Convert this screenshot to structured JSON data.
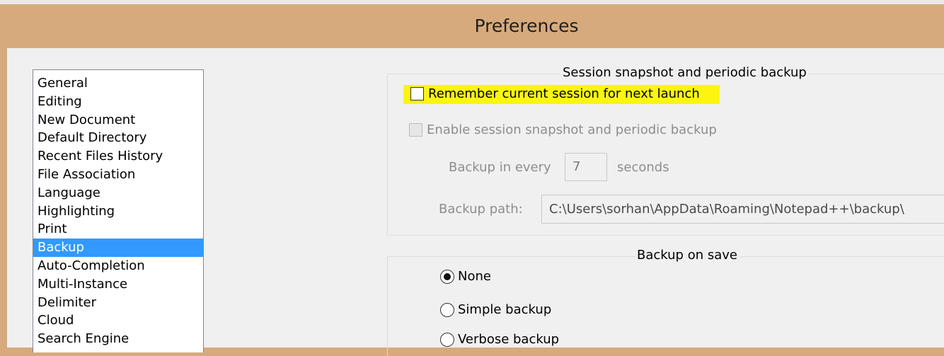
{
  "window": {
    "title": "Preferences",
    "frame_color": "#d6aa7c"
  },
  "categories": {
    "items": [
      "General",
      "Editing",
      "New Document",
      "Default Directory",
      "Recent Files History",
      "File Association",
      "Language",
      "Highlighting",
      "Print",
      "Backup",
      "Auto-Completion",
      "Multi-Instance",
      "Delimiter",
      "Cloud",
      "Search Engine"
    ],
    "selected": "Backup",
    "selected_color": "#3399ff"
  },
  "session_group": {
    "title": "Session snapshot and periodic backup",
    "remember_label": "Remember current session for next launch",
    "remember_checked": false,
    "highlight_color": "#fcf60f",
    "snapshot_label": "Enable session snapshot and periodic backup",
    "snapshot_checked": false,
    "backup_every_label": "Backup in every",
    "backup_every_value": "7",
    "seconds_label": "seconds",
    "backup_path_label": "Backup path:",
    "backup_path_value": "C:\\Users\\sorhan\\AppData\\Roaming\\Notepad++\\backup\\"
  },
  "save_group": {
    "title": "Backup on save",
    "options": [
      {
        "label": "None",
        "checked": true
      },
      {
        "label": "Simple backup",
        "checked": false
      },
      {
        "label": "Verbose backup",
        "checked": false
      }
    ]
  }
}
